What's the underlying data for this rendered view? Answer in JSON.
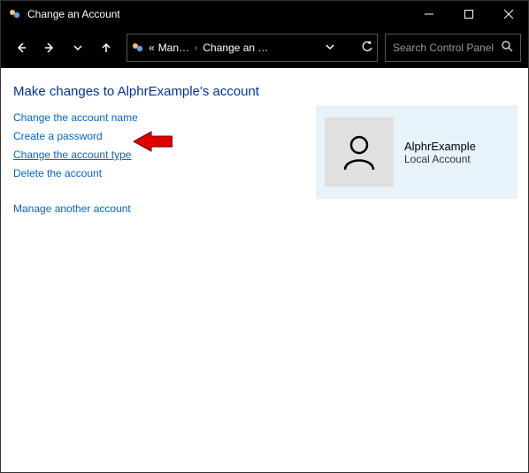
{
  "window": {
    "title": "Change an Account"
  },
  "breadcrumb": {
    "prefix": "«",
    "crumb1": "Man…",
    "crumb2": "Change an …"
  },
  "search": {
    "placeholder": "Search Control Panel"
  },
  "page": {
    "heading": "Make changes to AlphrExample's account",
    "links": {
      "change_name": "Change the account name",
      "create_password": "Create a password",
      "change_type": "Change the account type",
      "delete": "Delete the account",
      "manage_another": "Manage another account"
    }
  },
  "account": {
    "name": "AlphrExample",
    "type": "Local Account"
  }
}
